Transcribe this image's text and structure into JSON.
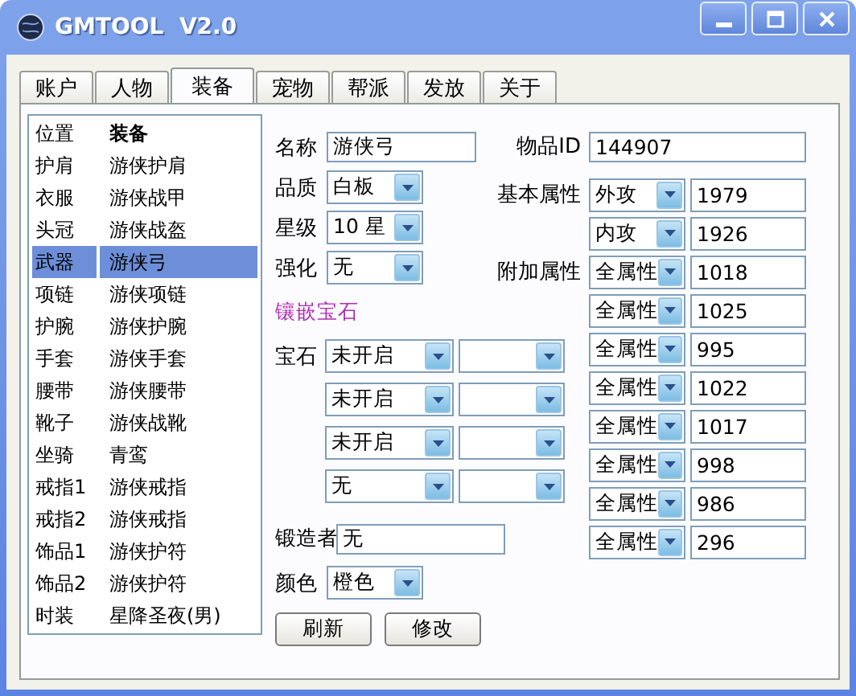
{
  "window": {
    "title": "GMTOOL  V2.0"
  },
  "tabs": [
    {
      "label": "账户",
      "selected": false
    },
    {
      "label": "人物",
      "selected": false
    },
    {
      "label": "装备",
      "selected": true
    },
    {
      "label": "宠物",
      "selected": false
    },
    {
      "label": "帮派",
      "selected": false
    },
    {
      "label": "发放",
      "selected": false
    },
    {
      "label": "关于",
      "selected": false
    }
  ],
  "equipment_list": {
    "columns": [
      "位置",
      "装备"
    ],
    "rows": [
      {
        "slot": "护肩",
        "item": "游侠护肩",
        "selected": false
      },
      {
        "slot": "衣服",
        "item": "游侠战甲",
        "selected": false
      },
      {
        "slot": "头冠",
        "item": "游侠战盔",
        "selected": false
      },
      {
        "slot": "武器",
        "item": "游侠弓",
        "selected": true
      },
      {
        "slot": "项链",
        "item": "游侠项链",
        "selected": false
      },
      {
        "slot": "护腕",
        "item": "游侠护腕",
        "selected": false
      },
      {
        "slot": "手套",
        "item": "游侠手套",
        "selected": false
      },
      {
        "slot": "腰带",
        "item": "游侠腰带",
        "selected": false
      },
      {
        "slot": "靴子",
        "item": "游侠战靴",
        "selected": false
      },
      {
        "slot": "坐骑",
        "item": "青鸾",
        "selected": false
      },
      {
        "slot": "戒指1",
        "item": "游侠戒指",
        "selected": false
      },
      {
        "slot": "戒指2",
        "item": "游侠戒指",
        "selected": false
      },
      {
        "slot": "饰品1",
        "item": "游侠护符",
        "selected": false
      },
      {
        "slot": "饰品2",
        "item": "游侠护符",
        "selected": false
      },
      {
        "slot": "时装",
        "item": "星降圣夜(男)",
        "selected": false
      }
    ]
  },
  "form": {
    "name": {
      "label": "名称",
      "value": "游侠弓"
    },
    "quality": {
      "label": "品质",
      "value": "白板"
    },
    "star": {
      "label": "星级",
      "value": "10 星"
    },
    "strengthen": {
      "label": "强化",
      "value": "无"
    },
    "gem_section": "镶嵌宝石",
    "gems": {
      "label": "宝石",
      "slots": [
        {
          "value": "未开启"
        },
        {
          "value": "未开启"
        },
        {
          "value": "未开启"
        },
        {
          "value": "无"
        }
      ]
    },
    "forger": {
      "label": "锻造者",
      "value": "无"
    },
    "color": {
      "label": "颜色",
      "value": "橙色"
    },
    "buttons": [
      "刷新",
      "修改"
    ],
    "item_id": {
      "label": "物品ID",
      "value": "144907"
    },
    "basic_attributes": {
      "label": "基本属性",
      "rows": [
        {
          "type": "外攻",
          "value": "1979"
        },
        {
          "type": "内攻",
          "value": "1926"
        }
      ]
    },
    "extra_attributes": {
      "label": "附加属性",
      "rows": [
        {
          "type": "全属性",
          "value": "1018"
        },
        {
          "type": "全属性",
          "value": "1025"
        },
        {
          "type": "全属性",
          "value": "995"
        },
        {
          "type": "全属性",
          "value": "1022"
        },
        {
          "type": "全属性",
          "value": "1017"
        },
        {
          "type": "全属性",
          "value": "998"
        },
        {
          "type": "全属性",
          "value": "986"
        },
        {
          "type": "全属性",
          "value": "296"
        }
      ]
    }
  }
}
